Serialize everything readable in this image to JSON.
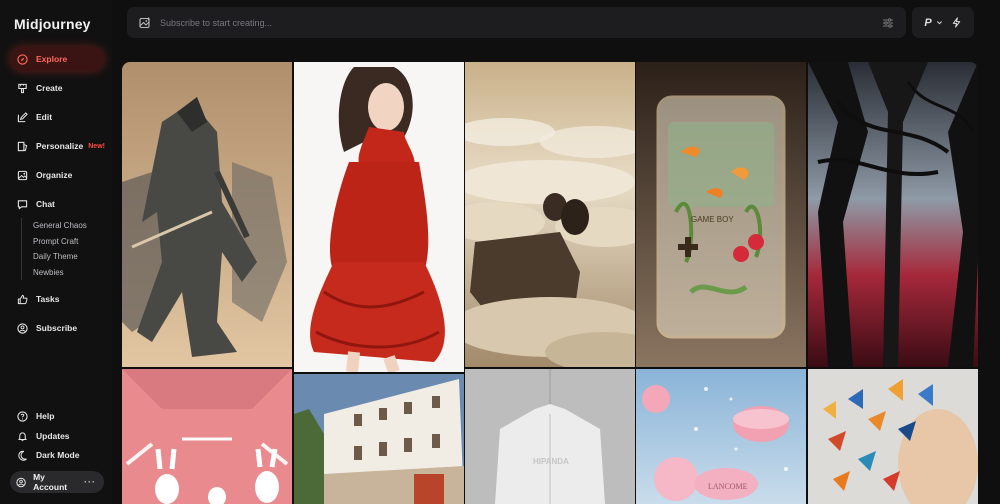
{
  "app": {
    "title": "Midjourney"
  },
  "nav": {
    "explore": "Explore",
    "create": "Create",
    "edit": "Edit",
    "personalize": "Personalize",
    "personalize_badge": "New!",
    "organize": "Organize",
    "chat": "Chat",
    "chat_channels": [
      "General Chaos",
      "Prompt Craft",
      "Daily Theme",
      "Newbies"
    ],
    "tasks": "Tasks",
    "subscribe": "Subscribe",
    "help": "Help",
    "updates": "Updates",
    "dark_mode": "Dark Mode",
    "account": "My Account"
  },
  "search": {
    "placeholder": "Subscribe to start creating..."
  },
  "profile": {
    "initial": "P"
  },
  "colors": {
    "accent": "#ff5a4a",
    "active_bg": "#3a1313"
  },
  "icons": [
    "explore-compass-icon",
    "create-brush-icon",
    "edit-pencil-icon",
    "personalize-icon",
    "organize-image-icon",
    "chat-bubble-icon",
    "tasks-thumbs-up-icon",
    "subscribe-user-icon",
    "help-icon",
    "updates-bell-icon",
    "dark-mode-moon-icon",
    "account-avatar-icon",
    "image-prompt-icon",
    "settings-sliders-icon",
    "lightning-icon",
    "chevron-down-icon"
  ],
  "gallery": {
    "tiles": [
      {
        "name": "origami-warrior"
      },
      {
        "name": "red-dress-woman"
      },
      {
        "name": "cloud-couple"
      },
      {
        "name": "aquarium-gameboy"
      },
      {
        "name": "red-forest"
      },
      {
        "name": "pink-rabbits"
      },
      {
        "name": "white-building"
      },
      {
        "name": "white-shirt"
      },
      {
        "name": "pink-macarons"
      },
      {
        "name": "butterfly-head"
      }
    ],
    "gameboy_text": "GAME BOY",
    "shirt_text": "HIPANDA",
    "macaron_text": "LANCOME"
  }
}
